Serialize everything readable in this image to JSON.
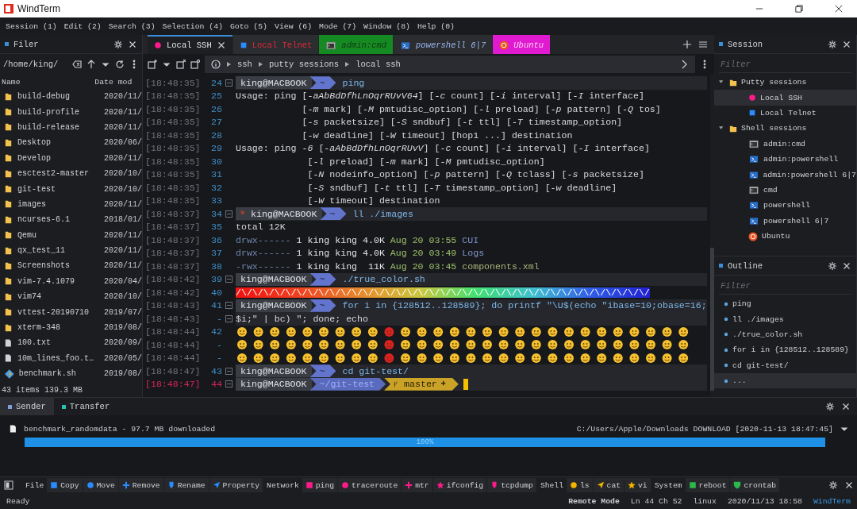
{
  "window": {
    "title": "WindTerm"
  },
  "menu": [
    "Session (1)",
    "Edit (2)",
    "Search (3)",
    "Selection (4)",
    "Goto (5)",
    "View (6)",
    "Mode (7)",
    "Window (8)",
    "Help (0)"
  ],
  "filer": {
    "title": "Filer",
    "path": "/home/king/",
    "columns": [
      "Name",
      "Date mod"
    ],
    "rows": [
      {
        "name": "build-debug",
        "date": "2020/11/",
        "kind": "folder"
      },
      {
        "name": "build-profile",
        "date": "2020/11/",
        "kind": "folder"
      },
      {
        "name": "build-release",
        "date": "2020/11/",
        "kind": "folder"
      },
      {
        "name": "Desktop",
        "date": "2020/06/",
        "kind": "folder"
      },
      {
        "name": "Develop",
        "date": "2020/11/",
        "kind": "folder"
      },
      {
        "name": "esctest2-master",
        "date": "2020/10/",
        "kind": "folder"
      },
      {
        "name": "git-test",
        "date": "2020/10/",
        "kind": "folder"
      },
      {
        "name": "images",
        "date": "2020/11/",
        "kind": "folder"
      },
      {
        "name": "ncurses-6.1",
        "date": "2018/01/",
        "kind": "folder"
      },
      {
        "name": "Qemu",
        "date": "2020/11/",
        "kind": "folder"
      },
      {
        "name": "qx_test_11",
        "date": "2020/11/",
        "kind": "folder"
      },
      {
        "name": "Screenshots",
        "date": "2020/11/",
        "kind": "folder"
      },
      {
        "name": "vim-7.4.1079",
        "date": "2020/04/",
        "kind": "folder"
      },
      {
        "name": "vim74",
        "date": "2020/10/",
        "kind": "folder"
      },
      {
        "name": "vttest-20190710",
        "date": "2019/07/",
        "kind": "folder"
      },
      {
        "name": "xterm-348",
        "date": "2019/08/",
        "kind": "folder"
      },
      {
        "name": "100.txt",
        "date": "2020/09/",
        "kind": "file"
      },
      {
        "name": "10m_lines_foo.t…",
        "date": "2020/05/",
        "kind": "file"
      },
      {
        "name": "benchmark.sh",
        "date": "2019/08/",
        "kind": "script"
      }
    ],
    "footer": "43 items 139.3 MB"
  },
  "tabs": [
    {
      "label": "Local SSH",
      "kind": "ssh",
      "selected": true,
      "color": "#1e1f22"
    },
    {
      "label": "Local Telnet",
      "kind": "telnet",
      "selected": false,
      "color": "#2b2d31"
    },
    {
      "label": "admin:cmd",
      "kind": "cmd",
      "selected": false,
      "color": "#168a22"
    },
    {
      "label": "powershell 6|7",
      "kind": "powershell",
      "selected": false,
      "color": "#2b2d31"
    },
    {
      "label": "Ubuntu",
      "kind": "ubuntu",
      "selected": false,
      "color": "#e01ad0"
    }
  ],
  "breadcrumb": [
    "ssh",
    "putty sessions",
    "local ssh"
  ],
  "terminal": [
    {
      "time": "[18:48:35]",
      "num": "24",
      "kind": "prompt",
      "user": "king@MACBOOK",
      "path": "~",
      "command": "ping",
      "error": false,
      "current": false
    },
    {
      "time": "[18:48:35]",
      "num": "25",
      "kind": "text",
      "text": "Usage: ping [*-aAbBdDfhLnOqrRUvV64*] [*-c* count] [*-i* interval] [*-I* interface]",
      "current": false
    },
    {
      "time": "[18:48:35]",
      "num": "26",
      "kind": "text",
      "text": "            [*-m* mark] [*-M* pmtudisc_option] [*-l* preload] [*-p* pattern] [*-Q* tos]",
      "current": false
    },
    {
      "time": "[18:48:35]",
      "num": "27",
      "kind": "text",
      "text": "            [*-s* packetsize] [*-S* sndbuf] [*-t* ttl] [*-T* timestamp_option]",
      "current": false
    },
    {
      "time": "[18:48:35]",
      "num": "28",
      "kind": "text",
      "text": "            [*-w* deadline] [*-W* timeout] [hop1 ...] destination",
      "current": false
    },
    {
      "time": "[18:48:35]",
      "num": "29",
      "kind": "text",
      "text": "Usage: ping *-6* [*-aAbBdDfhLnOqrRUvV*] [*-c* count] [*-i* interval] [*-I* interface]",
      "current": false
    },
    {
      "time": "[18:48:35]",
      "num": "30",
      "kind": "text",
      "text": "             [*-l* preload] [*-m* mark] [*-M* pmtudisc_option]",
      "current": false
    },
    {
      "time": "[18:48:35]",
      "num": "31",
      "kind": "text",
      "text": "             [*-N* nodeinfo_option] [*-p* pattern] [*-Q* tclass] [*-s* packetsize]",
      "current": false
    },
    {
      "time": "[18:48:35]",
      "num": "32",
      "kind": "text",
      "text": "             [*-S* sndbuf] [*-t* ttl] [*-T* timestamp_option] [*-w* deadline]",
      "current": false
    },
    {
      "time": "[18:48:35]",
      "num": "33",
      "kind": "text",
      "text": "             [*-W* timeout] destination",
      "current": false
    },
    {
      "time": "[18:48:37]",
      "num": "34",
      "kind": "prompt",
      "user": "king@MACBOOK",
      "path": "~",
      "command": "ll ./images",
      "error": true,
      "current": false
    },
    {
      "time": "[18:48:37]",
      "num": "35",
      "kind": "text",
      "text": "total 12K",
      "current": false
    },
    {
      "time": "[18:48:37]",
      "num": "36",
      "kind": "ls",
      "perms": "drwx------",
      "info": "1 king king 4.0K",
      "date": "Aug 20 03:55",
      "name": "CUI",
      "color": "#7d95c8",
      "current": false
    },
    {
      "time": "[18:48:37]",
      "num": "37",
      "kind": "ls",
      "perms": "drwx------",
      "info": "1 king king 4.0K",
      "date": "Aug 20 03:49",
      "name": "Logs",
      "color": "#7d95c8",
      "current": false
    },
    {
      "time": "[18:48:37]",
      "num": "38",
      "kind": "ls",
      "perms": "-rwx------",
      "info": "1 king king  11K",
      "date": "Aug 20 03:45",
      "name": "components.xml",
      "color": "#a6b57a",
      "current": false
    },
    {
      "time": "[18:48:42]",
      "num": "39",
      "kind": "prompt",
      "user": "king@MACBOOK",
      "path": "~",
      "command": "./true_color.sh",
      "error": false,
      "current": false
    },
    {
      "time": "[18:48:42]",
      "num": "40",
      "kind": "gradient",
      "text": "/\\/\\/\\/\\/\\/\\/\\/\\/\\/\\/\\/\\/\\/\\/\\/\\/\\/\\/\\/\\/\\/\\/\\/\\/\\/\\/\\/\\/\\/\\/\\/\\/\\/\\/\\/\\/\\/",
      "current": false
    },
    {
      "time": "[18:48:43]",
      "num": "41",
      "kind": "prompt",
      "user": "king@MACBOOK",
      "path": "~",
      "command": "for i in {128512..128589}; do printf \"\\U$(echo \"ibase=10;obase=16;",
      "error": false,
      "current": false
    },
    {
      "time": "[18:48:43]",
      "num": "-",
      "kind": "continuation",
      "text": "$i;\" | bc) \"; done; echo",
      "current": false
    },
    {
      "time": "[18:48:44]",
      "num": "42",
      "kind": "emoji",
      "current": false
    },
    {
      "time": "[18:48:44]",
      "num": "-",
      "kind": "emoji",
      "current": false
    },
    {
      "time": "[18:48:44]",
      "num": "-",
      "kind": "emoji",
      "current": false
    },
    {
      "time": "[18:48:47]",
      "num": "43",
      "kind": "prompt",
      "user": "king@MACBOOK",
      "path": "~",
      "command": "cd git-test/",
      "error": false,
      "current": false
    },
    {
      "time": "[18:48:47]",
      "num": "44",
      "kind": "prompt",
      "user": "king@MACBOOK",
      "path": "~/git-test",
      "branch": "master",
      "error": false,
      "current": true
    }
  ],
  "session": {
    "title": "Session",
    "placeholder": "Filter",
    "tree": [
      {
        "label": "Putty sessions",
        "kind": "folder",
        "expanded": true,
        "selected": false,
        "children": [
          {
            "label": "Local SSH",
            "kind": "ssh",
            "selected": true
          },
          {
            "label": "Local Telnet",
            "kind": "telnet",
            "selected": false
          }
        ]
      },
      {
        "label": "Shell sessions",
        "kind": "folder",
        "expanded": true,
        "selected": false,
        "children": [
          {
            "label": "admin:cmd",
            "kind": "cmd",
            "selected": false
          },
          {
            "label": "admin:powershell",
            "kind": "powershell",
            "selected": false
          },
          {
            "label": "admin:powershell 6|7",
            "kind": "powershell",
            "selected": false
          },
          {
            "label": "cmd",
            "kind": "cmd",
            "selected": false
          },
          {
            "label": "powershell",
            "kind": "powershell",
            "selected": false
          },
          {
            "label": "powershell 6|7",
            "kind": "powershell",
            "selected": false
          },
          {
            "label": "Ubuntu",
            "kind": "ubuntu",
            "selected": false
          }
        ]
      }
    ]
  },
  "outline": {
    "title": "Outline",
    "placeholder": "Filter",
    "items": [
      {
        "label": "ping",
        "selected": false
      },
      {
        "label": "ll ./images",
        "selected": false
      },
      {
        "label": "./true_color.sh",
        "selected": false
      },
      {
        "label": "for i in {128512..128589}",
        "selected": false
      },
      {
        "label": "cd git-test/",
        "selected": false
      },
      {
        "label": "...",
        "selected": true
      }
    ]
  },
  "transfer": {
    "tabs": [
      {
        "label": "Sender",
        "selected": true
      },
      {
        "label": "Transfer",
        "selected": false
      }
    ],
    "file": "benchmark_randomdata - 97.7 MB downloaded",
    "destination": "C:/Users/Apple/Downloads DOWNLOAD [2020-11-13 18:47:45]",
    "level": 1,
    "progress": "100%"
  },
  "quickbar": [
    {
      "label": "File",
      "kind": "group"
    },
    {
      "label": "Copy",
      "kind": "square",
      "color": "#2a8cff"
    },
    {
      "label": "Move",
      "kind": "circle",
      "color": "#2a8cff"
    },
    {
      "label": "Remove",
      "kind": "cross",
      "color": "#2a8cff"
    },
    {
      "label": "Rename",
      "kind": "pin",
      "color": "#2a8cff"
    },
    {
      "label": "Property",
      "kind": "arrow",
      "color": "#2a8cff"
    },
    {
      "label": "Network",
      "kind": "group"
    },
    {
      "label": "ping",
      "kind": "square",
      "color": "#ff1a8c"
    },
    {
      "label": "traceroute",
      "kind": "circle",
      "color": "#ff1a8c"
    },
    {
      "label": "mtr",
      "kind": "cross",
      "color": "#ff1a8c"
    },
    {
      "label": "ifconfig",
      "kind": "star",
      "color": "#ff1a8c"
    },
    {
      "label": "tcpdump",
      "kind": "pin",
      "color": "#ff1a8c"
    },
    {
      "label": "Shell",
      "kind": "group"
    },
    {
      "label": "ls",
      "kind": "circle",
      "color": "#f5b400"
    },
    {
      "label": "cat",
      "kind": "arrow",
      "color": "#f5b400"
    },
    {
      "label": "vi",
      "kind": "star",
      "color": "#f5b400"
    },
    {
      "label": "System",
      "kind": "group"
    },
    {
      "label": "reboot",
      "kind": "square",
      "color": "#2db84a"
    },
    {
      "label": "crontab",
      "kind": "shield",
      "color": "#2db84a"
    }
  ],
  "status": {
    "left": "Ready",
    "mode": "Remote Mode",
    "position": "Ln 44 Ch 52",
    "os": "linux",
    "time": "2020/11/13 18:58",
    "app": "WindTerm"
  }
}
